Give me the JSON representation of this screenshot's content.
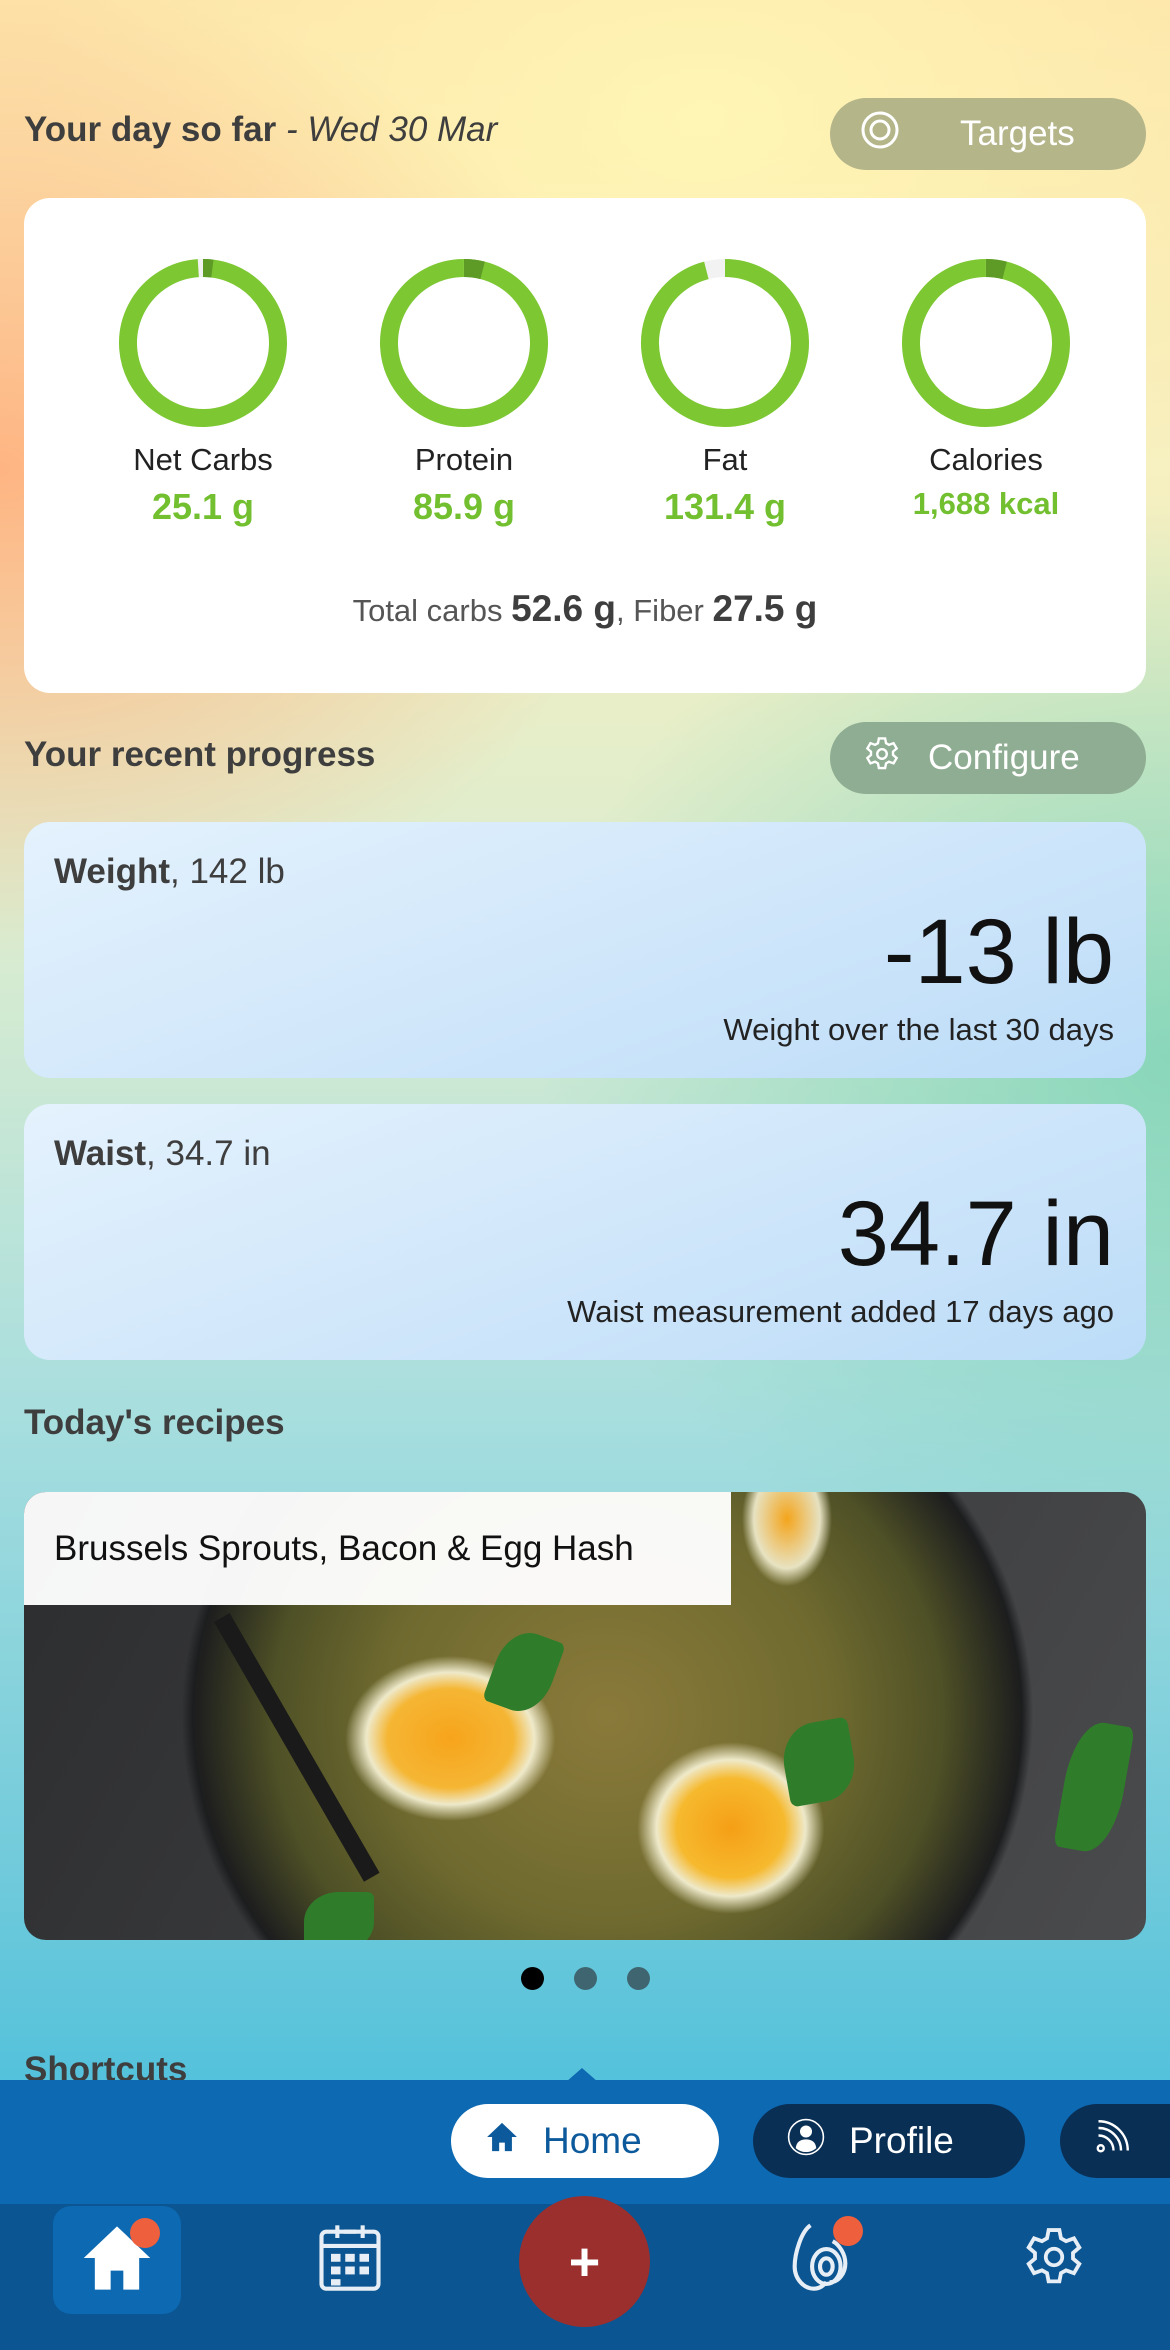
{
  "day_header": {
    "title": "Your day so far",
    "date": "- Wed 30 Mar",
    "targets_label": "Targets",
    "targets_icon": "target-icon"
  },
  "macros": [
    {
      "name": "Net Carbs",
      "value": "25.1 g",
      "progress": 0.99,
      "over": 0.02
    },
    {
      "name": "Protein",
      "value": "85.9 g",
      "progress": 1.0,
      "over": 0.04
    },
    {
      "name": "Fat",
      "value": "131.4 g",
      "progress": 0.96,
      "over": 0
    },
    {
      "name": "Calories",
      "value": "1,688 kcal",
      "progress": 1.0,
      "over": 0.04
    }
  ],
  "totals": {
    "total_carbs_label": "Total carbs",
    "total_carbs_value": "52.6 g",
    "fiber_label": ", Fiber",
    "fiber_value": "27.5 g"
  },
  "colors": {
    "ring": "#7dc832",
    "ring_over": "#5e9a26",
    "ring_track": "#f2f2f2",
    "value_green": "#72bf2f",
    "nav_bg": "#0b5592",
    "tab_strip_bg": "#0c69b2",
    "add_button": "#9b2f2d",
    "badge": "#ee5f3d"
  },
  "progress_section": {
    "title": "Your recent progress",
    "configure_label": "Configure",
    "configure_icon": "gear-icon",
    "cards": [
      {
        "label": "Weight",
        "current": ", 142 lb",
        "big_value": "-13 lb",
        "subtitle": "Weight over the last 30 days"
      },
      {
        "label": "Waist",
        "current": ", 34.7 in",
        "big_value": "34.7 in",
        "subtitle": "Waist measurement added 17 days ago"
      }
    ]
  },
  "recipes_section": {
    "title": "Today's recipes",
    "recipe_title": "Brussels Sprouts, Bacon & Egg Hash",
    "carousel_pages": 3,
    "active_page": 1
  },
  "shortcuts_section": {
    "title": "Shortcuts"
  },
  "tab_strip": {
    "tabs": [
      {
        "label": "Home",
        "icon": "home-icon",
        "active": true
      },
      {
        "label": "Profile",
        "icon": "profile-icon",
        "active": false
      },
      {
        "label": "",
        "icon": "feed-icon",
        "active": false
      }
    ]
  },
  "bottom_nav": {
    "items": [
      {
        "name": "home",
        "icon": "home-icon",
        "active": true,
        "badge": true
      },
      {
        "name": "calendar",
        "icon": "calendar-icon",
        "active": false,
        "badge": false
      },
      {
        "name": "add",
        "icon": "plus-icon",
        "label": "+",
        "active": false,
        "badge": false
      },
      {
        "name": "food",
        "icon": "avocado-icon",
        "active": false,
        "badge": true
      },
      {
        "name": "settings",
        "icon": "gear-icon",
        "active": false,
        "badge": false
      }
    ]
  }
}
